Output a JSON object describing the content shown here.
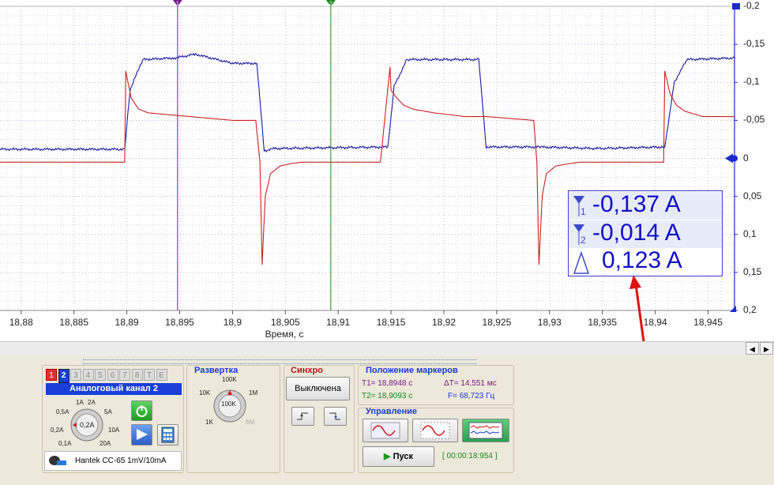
{
  "chart_data": {
    "type": "line",
    "x_ticks": [
      "18,88",
      "18,885",
      "18,89",
      "18,895",
      "18,9",
      "18,905",
      "18,91",
      "18,915",
      "18,92",
      "18,925",
      "18,93",
      "18,935",
      "18,94",
      "18,945"
    ],
    "y_ticks": [
      "-0,2",
      "-0,15",
      "-0,1",
      "-0,05",
      "0",
      "0,05",
      "0,1",
      "0,15",
      "0,2"
    ],
    "xlabel": "Время, с",
    "xlim": [
      18.878,
      18.9475
    ],
    "ylim": [
      0.2,
      -0.2
    ],
    "grid": true,
    "series": [
      {
        "color": "#1a1aa0",
        "x": [
          18.878,
          18.8898,
          18.8903,
          18.8915,
          18.8945,
          18.8965,
          18.9,
          18.9023,
          18.903,
          18.904,
          18.9147,
          18.9153,
          18.9165,
          18.92,
          18.9233,
          18.924,
          18.929,
          18.9345,
          18.9409,
          18.9418,
          18.943,
          18.9475
        ],
        "y": [
          -0.012,
          -0.012,
          -0.09,
          -0.13,
          -0.132,
          -0.137,
          -0.125,
          -0.125,
          -0.01,
          -0.013,
          -0.015,
          -0.095,
          -0.13,
          -0.13,
          -0.13,
          -0.015,
          -0.015,
          -0.013,
          -0.015,
          -0.1,
          -0.13,
          -0.132
        ]
      },
      {
        "color": "#cc2020",
        "x": [
          18.878,
          18.8898,
          18.8899,
          18.8904,
          18.8911,
          18.892,
          18.8935,
          18.896,
          18.9,
          18.9022,
          18.9026,
          18.9028,
          18.9031,
          18.9036,
          18.9045,
          18.9055,
          18.9065,
          18.914,
          18.9149,
          18.915,
          18.9155,
          18.9162,
          18.917,
          18.919,
          18.922,
          18.924,
          18.9285,
          18.9288,
          18.929,
          18.9293,
          18.9297,
          18.9306,
          18.9318,
          18.9328,
          18.9408,
          18.9409,
          18.9414,
          18.942,
          18.9428,
          18.9445,
          18.9475
        ],
        "y": [
          0.005,
          0.005,
          -0.115,
          -0.08,
          -0.065,
          -0.06,
          -0.058,
          -0.055,
          -0.05,
          -0.05,
          0.005,
          0.14,
          0.05,
          0.02,
          0.01,
          0.007,
          0.005,
          0.005,
          -0.12,
          -0.09,
          -0.08,
          -0.07,
          -0.065,
          -0.06,
          -0.055,
          -0.055,
          -0.05,
          0.005,
          0.14,
          0.05,
          0.02,
          0.01,
          0.007,
          0.005,
          0.005,
          -0.115,
          -0.085,
          -0.07,
          -0.062,
          -0.055,
          -0.055
        ]
      }
    ],
    "markers": [
      {
        "label": "1",
        "x": 18.8948,
        "color": "#7a1a8a"
      },
      {
        "label": "2",
        "x": 18.9093,
        "color": "#1a8a1a"
      }
    ]
  },
  "readout": {
    "row1": "-0,137 A",
    "row2": "-0,014 A",
    "row3": "0,123 A",
    "row1_index": "1",
    "row2_index": "2"
  },
  "channel": {
    "tabs": [
      "1",
      "2",
      "3",
      "4",
      "5",
      "6",
      "7",
      "8",
      "T",
      "E"
    ],
    "title": "Аналоговый канал 2",
    "knob_labels": [
      "1A",
      "2A",
      "0,5A",
      "5A",
      "0,2A",
      "10A",
      "0,1A",
      "20A"
    ],
    "knob_value": "0,2A",
    "probe": "Hantek CC-65 1mV/10mA"
  },
  "sweep": {
    "title": "Развертка",
    "knob_labels": [
      "100K",
      "10K",
      "1M",
      "1K",
      "6M"
    ],
    "knob_value": "100K"
  },
  "sync": {
    "title": "Синхро",
    "mode": "Выключена"
  },
  "markers_pos": {
    "title": "Положение маркеров",
    "t1": "T1= 18,8948 с",
    "t2": "T2= 18,9093 с",
    "dt": "ΔT= 14,551 мс",
    "f": "F= 68,723 Гц"
  },
  "control": {
    "title": "Управление",
    "run": "Пуск",
    "time": "[ 00:00:18:954 ]"
  },
  "colors": {
    "ch1": "#e23030",
    "ch2": "#1a3ad6",
    "panel": "#ede9dc",
    "accent": "#1a3ad6"
  }
}
